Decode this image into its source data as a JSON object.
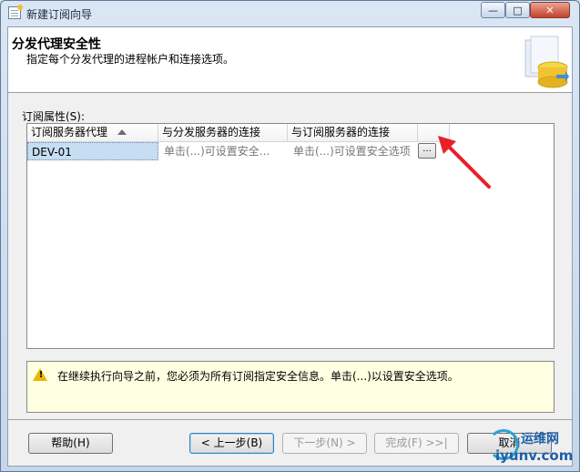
{
  "window": {
    "title": "新建订阅向导",
    "controls": {
      "minimize": "—",
      "maximize": "□",
      "close": "✕"
    }
  },
  "header": {
    "title": "分发代理安全性",
    "subtitle": "指定每个分发代理的进程帐户和连接选项。"
  },
  "properties": {
    "label": "订阅属性(S):",
    "columns": [
      "订阅服务器代理",
      "与分发服务器的连接",
      "与订阅服务器的连接"
    ],
    "rows": [
      {
        "agent": "DEV-01",
        "distributor_conn": "单击(...)可设置安全...",
        "subscriber_conn": "单击(...)可设置安全选项",
        "button": "..."
      }
    ]
  },
  "warning": {
    "icon": "warning-icon",
    "text": "在继续执行向导之前，您必须为所有订阅指定安全信息。单击(...)以设置安全选项。"
  },
  "buttons": {
    "help": "帮助(H)",
    "back": "< 上一步(B)",
    "next": "下一步(N) >",
    "finish": "完成(F) >>|",
    "cancel": "取消"
  },
  "watermark": {
    "line1": "运维网",
    "line2": "iyunv.com"
  },
  "colors": {
    "selection": "#c7ddf2",
    "warning_bg": "#ffffe1",
    "annotation_arrow": "#e8202a"
  }
}
